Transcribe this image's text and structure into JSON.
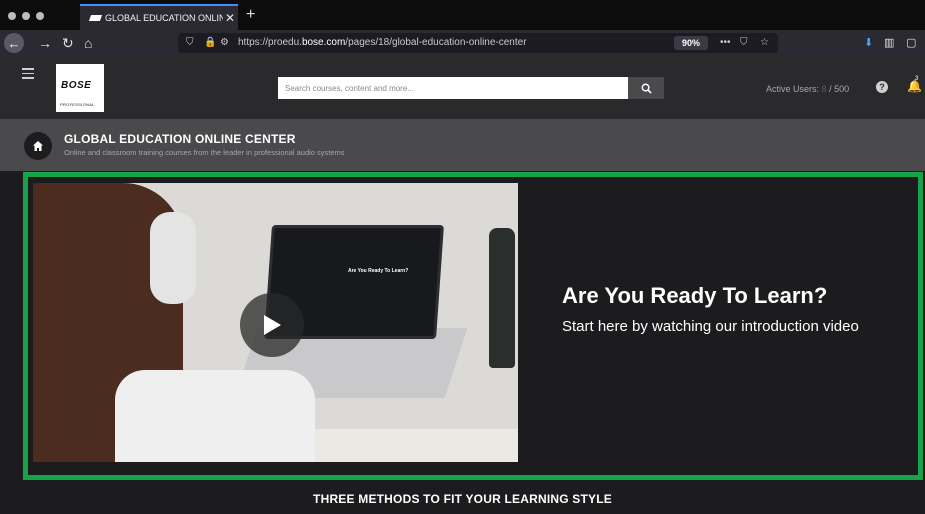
{
  "browser": {
    "tab_title": "GLOBAL EDUCATION ONLINE C",
    "url_prefix": "https://proedu.",
    "url_domain": "bose.com",
    "url_path": "/pages/18/global-education-online-center",
    "zoom": "90%"
  },
  "header": {
    "logo_text": "BOSE",
    "logo_subtext": "PROFESSIONAL",
    "search_placeholder": "Search courses, content and more...",
    "active_users_label": "Active Users:",
    "active_users_count": "8",
    "active_users_max": "/ 500",
    "notification_count": "3"
  },
  "title_band": {
    "title": "GLOBAL EDUCATION ONLINE CENTER",
    "subtitle": "Online and classroom training courses from the leader in professional audio systems"
  },
  "hero": {
    "video_caption": "Are You Ready To Learn?",
    "heading": "Are You Ready To Learn?",
    "subheading": "Start here by watching our introduction video"
  },
  "section": {
    "methods_heading": "THREE METHODS TO FIT YOUR LEARNING STYLE"
  },
  "colors": {
    "accent_green": "#16a34a",
    "dark_bg": "#1c1c1e",
    "band_gray": "#4a4a4c"
  }
}
